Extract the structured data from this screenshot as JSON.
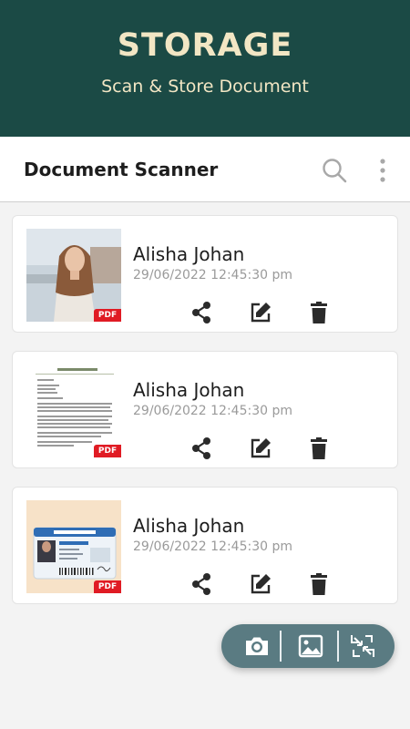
{
  "banner": {
    "title": "STORAGE",
    "subtitle": "Scan & Store Document"
  },
  "appbar": {
    "title": "Document Scanner",
    "search_icon": "search-icon",
    "more_icon": "more-vert-icon"
  },
  "documents": [
    {
      "name": "Alisha Johan",
      "date": "29/06/2022 12:45:30 pm",
      "badge": "PDF"
    },
    {
      "name": "Alisha Johan",
      "date": "29/06/2022 12:45:30 pm",
      "badge": "PDF"
    },
    {
      "name": "Alisha Johan",
      "date": "29/06/2022 12:45:30 pm",
      "badge": "PDF"
    }
  ],
  "actions": [
    "share-icon",
    "edit-icon",
    "delete-icon"
  ],
  "fab": [
    "camera-icon",
    "gallery-icon",
    "compress-icon"
  ],
  "colors": {
    "banner": "#1b4a45",
    "banner_text": "#f2e6c4",
    "fab": "#5a7b82",
    "pdf": "#e01b24",
    "icon": "#2b2b2b"
  }
}
